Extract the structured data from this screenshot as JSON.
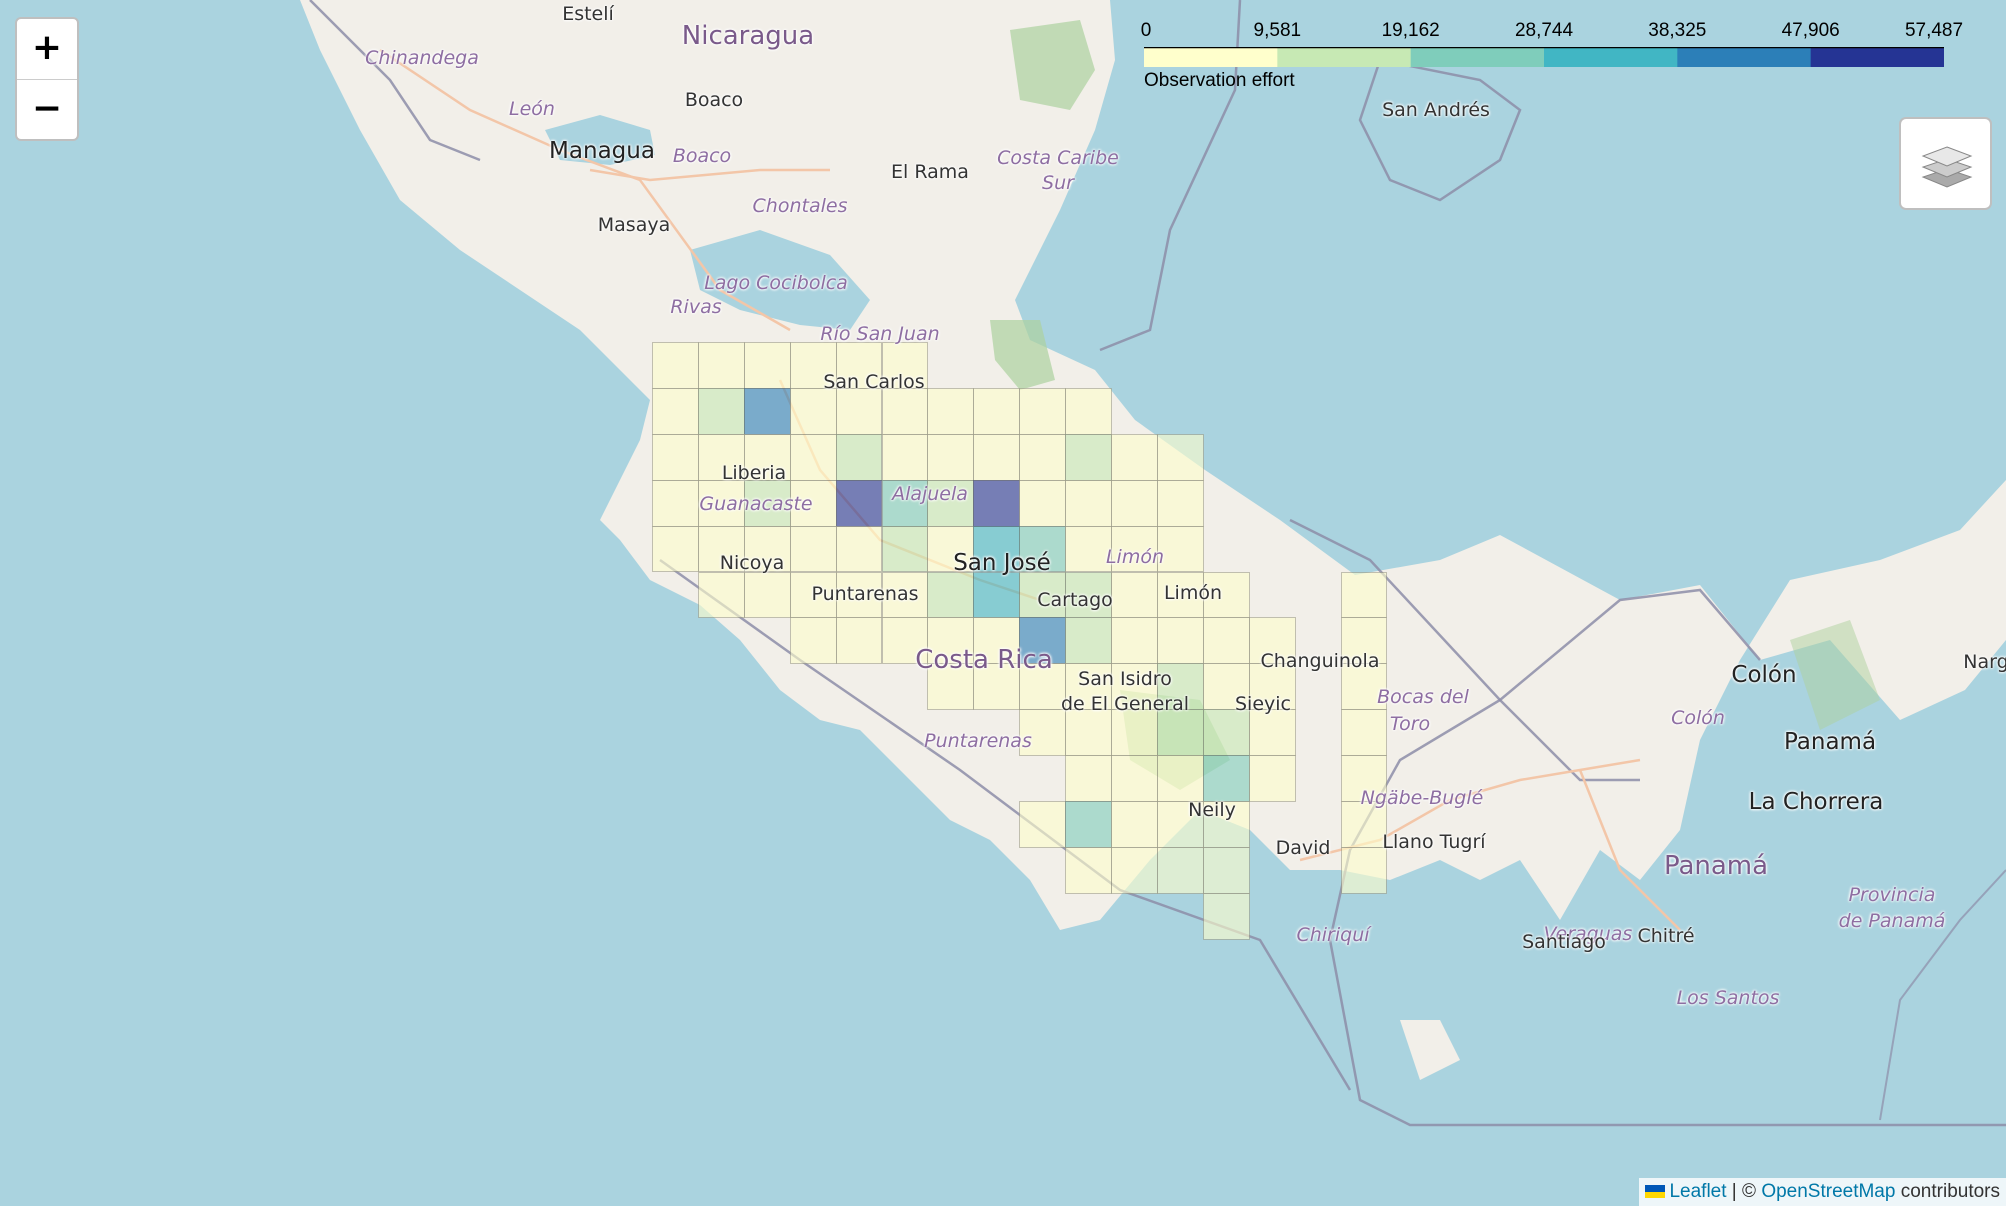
{
  "colors": {
    "water": "#aad3df",
    "land": "#f2efe9",
    "border": "#8d8da8",
    "forest": "#add19e",
    "road": "#f3c6a8",
    "scale": [
      "#ffffcc",
      "#c7e9b4",
      "#7fcdbb",
      "#41b6c4",
      "#2c7fb8",
      "#253494"
    ]
  },
  "map": {
    "places": [
      {
        "name": "Estelí",
        "type": "city"
      },
      {
        "name": "Nicaragua",
        "type": "country"
      },
      {
        "name": "Chinandega",
        "type": "region"
      },
      {
        "name": "León",
        "type": "region"
      },
      {
        "name": "Boaco",
        "type": "city"
      },
      {
        "name": "Managua",
        "type": "big-city"
      },
      {
        "name": "Boaco",
        "type": "region"
      },
      {
        "name": "El Rama",
        "type": "city"
      },
      {
        "name": "Costa Caribe",
        "type": "region"
      },
      {
        "name": "Sur",
        "type": "region"
      },
      {
        "name": "Masaya",
        "type": "city"
      },
      {
        "name": "Chontales",
        "type": "region"
      },
      {
        "name": "San Andrés",
        "type": "city"
      },
      {
        "name": "Lago Cocibolca",
        "type": "region"
      },
      {
        "name": "Rivas",
        "type": "region"
      },
      {
        "name": "Río San Juan",
        "type": "region"
      },
      {
        "name": "San Carlos",
        "type": "city"
      },
      {
        "name": "Liberia",
        "type": "city"
      },
      {
        "name": "Alajuela",
        "type": "region"
      },
      {
        "name": "Guanacaste",
        "type": "region"
      },
      {
        "name": "San José",
        "type": "big-city"
      },
      {
        "name": "Limón",
        "type": "region"
      },
      {
        "name": "Nicoya",
        "type": "city"
      },
      {
        "name": "Cartago",
        "type": "city"
      },
      {
        "name": "Limón",
        "type": "city"
      },
      {
        "name": "Puntarenas",
        "type": "city"
      },
      {
        "name": "Costa Rica",
        "type": "country"
      },
      {
        "name": "Changuinola",
        "type": "city"
      },
      {
        "name": "San Isidro",
        "type": "city"
      },
      {
        "name": "de El General",
        "type": "city"
      },
      {
        "name": "Sieyic",
        "type": "city"
      },
      {
        "name": "Bocas del",
        "type": "region"
      },
      {
        "name": "Toro",
        "type": "region"
      },
      {
        "name": "Puntarenas",
        "type": "region"
      },
      {
        "name": "Colón",
        "type": "big-city"
      },
      {
        "name": "Colón",
        "type": "region"
      },
      {
        "name": "Panamá",
        "type": "big-city"
      },
      {
        "name": "Narg",
        "type": "city"
      },
      {
        "name": "La Chorrera",
        "type": "big-city"
      },
      {
        "name": "Ngäbe-Buglé",
        "type": "region"
      },
      {
        "name": "Neily",
        "type": "city"
      },
      {
        "name": "David",
        "type": "city"
      },
      {
        "name": "Llano Tugrí",
        "type": "city"
      },
      {
        "name": "Panamá",
        "type": "country"
      },
      {
        "name": "Veraguas",
        "type": "region"
      },
      {
        "name": "Provincia",
        "type": "region"
      },
      {
        "name": "de Panamá",
        "type": "region"
      },
      {
        "name": "Santiago",
        "type": "city"
      },
      {
        "name": "Chitré",
        "type": "city"
      },
      {
        "name": "Chiriquí",
        "type": "region"
      },
      {
        "name": "Los Santos",
        "type": "region"
      }
    ]
  },
  "legend": {
    "title": "Observation effort",
    "ticks": [
      "0",
      "9,581",
      "19,162",
      "28,744",
      "38,325",
      "47,906",
      "57,487"
    ],
    "breaks": [
      0,
      9581,
      19162,
      28744,
      38325,
      47906,
      57487
    ]
  },
  "grid": {
    "opacity": 0.6,
    "cells": [
      {
        "col": 0,
        "row": 0,
        "level": 0
      },
      {
        "col": 1,
        "row": 0,
        "level": 0
      },
      {
        "col": 2,
        "row": 0,
        "level": 0
      },
      {
        "col": 3,
        "row": 0,
        "level": 0
      },
      {
        "col": 4,
        "row": 0,
        "level": 0
      },
      {
        "col": 5,
        "row": 0,
        "level": 0
      },
      {
        "col": 0,
        "row": 1,
        "level": 0
      },
      {
        "col": 1,
        "row": 1,
        "level": 1
      },
      {
        "col": 2,
        "row": 1,
        "level": 4
      },
      {
        "col": 3,
        "row": 1,
        "level": 0
      },
      {
        "col": 4,
        "row": 1,
        "level": 0
      },
      {
        "col": 5,
        "row": 1,
        "level": 0
      },
      {
        "col": 6,
        "row": 1,
        "level": 0
      },
      {
        "col": 7,
        "row": 1,
        "level": 0
      },
      {
        "col": 8,
        "row": 1,
        "level": 0
      },
      {
        "col": 9,
        "row": 1,
        "level": 0
      },
      {
        "col": 0,
        "row": 2,
        "level": 0
      },
      {
        "col": 1,
        "row": 2,
        "level": 0
      },
      {
        "col": 2,
        "row": 2,
        "level": 0
      },
      {
        "col": 3,
        "row": 2,
        "level": 0
      },
      {
        "col": 4,
        "row": 2,
        "level": 1
      },
      {
        "col": 5,
        "row": 2,
        "level": 0
      },
      {
        "col": 6,
        "row": 2,
        "level": 0
      },
      {
        "col": 7,
        "row": 2,
        "level": 0
      },
      {
        "col": 8,
        "row": 2,
        "level": 0
      },
      {
        "col": 9,
        "row": 2,
        "level": 1
      },
      {
        "col": 10,
        "row": 2,
        "level": 0
      },
      {
        "col": 11,
        "row": 2,
        "level": 0
      },
      {
        "col": 0,
        "row": 3,
        "level": 0
      },
      {
        "col": 1,
        "row": 3,
        "level": 0
      },
      {
        "col": 2,
        "row": 3,
        "level": 1
      },
      {
        "col": 3,
        "row": 3,
        "level": 0
      },
      {
        "col": 4,
        "row": 3,
        "level": 5
      },
      {
        "col": 5,
        "row": 3,
        "level": 2
      },
      {
        "col": 6,
        "row": 3,
        "level": 1
      },
      {
        "col": 7,
        "row": 3,
        "level": 5
      },
      {
        "col": 8,
        "row": 3,
        "level": 0
      },
      {
        "col": 9,
        "row": 3,
        "level": 0
      },
      {
        "col": 10,
        "row": 3,
        "level": 0
      },
      {
        "col": 11,
        "row": 3,
        "level": 0
      },
      {
        "col": 0,
        "row": 4,
        "level": 0
      },
      {
        "col": 1,
        "row": 4,
        "level": 0
      },
      {
        "col": 2,
        "row": 4,
        "level": 0
      },
      {
        "col": 3,
        "row": 4,
        "level": 0
      },
      {
        "col": 4,
        "row": 4,
        "level": 0
      },
      {
        "col": 5,
        "row": 4,
        "level": 1
      },
      {
        "col": 6,
        "row": 4,
        "level": 0
      },
      {
        "col": 7,
        "row": 4,
        "level": 3
      },
      {
        "col": 8,
        "row": 4,
        "level": 2
      },
      {
        "col": 9,
        "row": 4,
        "level": 0
      },
      {
        "col": 10,
        "row": 4,
        "level": 0
      },
      {
        "col": 11,
        "row": 4,
        "level": 0
      },
      {
        "col": 1,
        "row": 5,
        "level": 0
      },
      {
        "col": 2,
        "row": 5,
        "level": 0
      },
      {
        "col": 3,
        "row": 5,
        "level": 0
      },
      {
        "col": 4,
        "row": 5,
        "level": 0
      },
      {
        "col": 5,
        "row": 5,
        "level": 0
      },
      {
        "col": 6,
        "row": 5,
        "level": 1
      },
      {
        "col": 7,
        "row": 5,
        "level": 3
      },
      {
        "col": 8,
        "row": 5,
        "level": 1
      },
      {
        "col": 9,
        "row": 5,
        "level": 1
      },
      {
        "col": 10,
        "row": 5,
        "level": 0
      },
      {
        "col": 11,
        "row": 5,
        "level": 0
      },
      {
        "col": 12,
        "row": 5,
        "level": 0
      },
      {
        "col": 15,
        "row": 5,
        "level": 0
      },
      {
        "col": 3,
        "row": 6,
        "level": 0
      },
      {
        "col": 4,
        "row": 6,
        "level": 0
      },
      {
        "col": 5,
        "row": 6,
        "level": 0
      },
      {
        "col": 6,
        "row": 6,
        "level": 0
      },
      {
        "col": 7,
        "row": 6,
        "level": 0
      },
      {
        "col": 8,
        "row": 6,
        "level": 4
      },
      {
        "col": 9,
        "row": 6,
        "level": 1
      },
      {
        "col": 10,
        "row": 6,
        "level": 0
      },
      {
        "col": 11,
        "row": 6,
        "level": 0
      },
      {
        "col": 12,
        "row": 6,
        "level": 0
      },
      {
        "col": 13,
        "row": 6,
        "level": 0
      },
      {
        "col": 15,
        "row": 6,
        "level": 0
      },
      {
        "col": 6,
        "row": 7,
        "level": 0
      },
      {
        "col": 7,
        "row": 7,
        "level": 0
      },
      {
        "col": 8,
        "row": 7,
        "level": 0
      },
      {
        "col": 9,
        "row": 7,
        "level": 0
      },
      {
        "col": 10,
        "row": 7,
        "level": 0
      },
      {
        "col": 11,
        "row": 7,
        "level": 1
      },
      {
        "col": 12,
        "row": 7,
        "level": 0
      },
      {
        "col": 13,
        "row": 7,
        "level": 0
      },
      {
        "col": 15,
        "row": 7,
        "level": 0
      },
      {
        "col": 8,
        "row": 8,
        "level": 0
      },
      {
        "col": 9,
        "row": 8,
        "level": 0
      },
      {
        "col": 10,
        "row": 8,
        "level": 0
      },
      {
        "col": 11,
        "row": 8,
        "level": 1
      },
      {
        "col": 12,
        "row": 8,
        "level": 1
      },
      {
        "col": 13,
        "row": 8,
        "level": 0
      },
      {
        "col": 15,
        "row": 8,
        "level": 0
      },
      {
        "col": 9,
        "row": 9,
        "level": 0
      },
      {
        "col": 10,
        "row": 9,
        "level": 0
      },
      {
        "col": 11,
        "row": 9,
        "level": 0
      },
      {
        "col": 12,
        "row": 9,
        "level": 2
      },
      {
        "col": 13,
        "row": 9,
        "level": 0
      },
      {
        "col": 15,
        "row": 9,
        "level": 0
      },
      {
        "col": 8,
        "row": 10,
        "level": 0
      },
      {
        "col": 9,
        "row": 10,
        "level": 2
      },
      {
        "col": 10,
        "row": 10,
        "level": 0
      },
      {
        "col": 11,
        "row": 10,
        "level": 0
      },
      {
        "col": 12,
        "row": 10,
        "level": 0
      },
      {
        "col": 15,
        "row": 10,
        "level": 0
      },
      {
        "col": 9,
        "row": 11,
        "level": 0
      },
      {
        "col": 10,
        "row": 11,
        "level": 0
      },
      {
        "col": 11,
        "row": 11,
        "level": 0
      },
      {
        "col": 12,
        "row": 11,
        "level": 0
      },
      {
        "col": 15,
        "row": 11,
        "level": 0
      },
      {
        "col": 12,
        "row": 12,
        "level": 0
      }
    ]
  },
  "controls": {
    "zoom_in": "+",
    "zoom_out": "−"
  },
  "attribution": {
    "leaflet": "Leaflet",
    "separator": " | © ",
    "osm": "OpenStreetMap",
    "suffix": " contributors"
  }
}
